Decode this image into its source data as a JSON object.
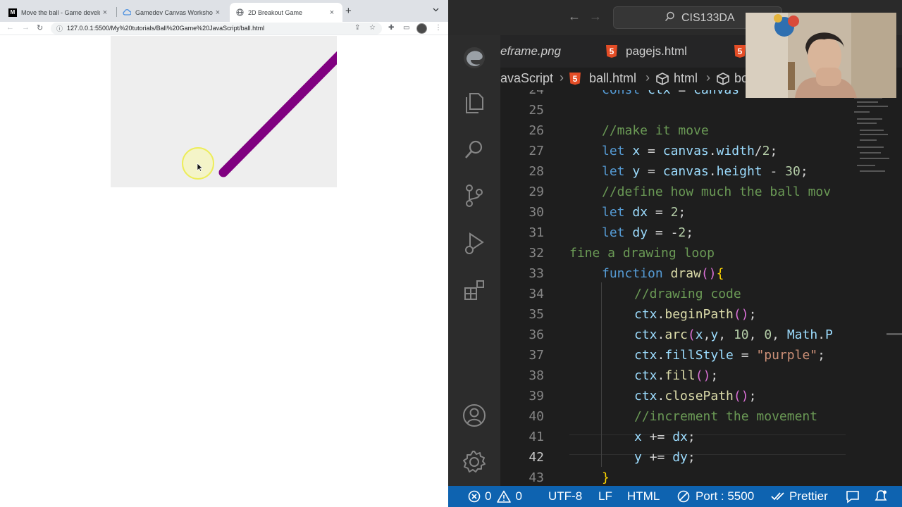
{
  "browser": {
    "tabs": [
      {
        "title": "Move the ball - Game develop",
        "icon": "mdn-icon",
        "active": false
      },
      {
        "title": "Gamedev Canvas Workshop - ",
        "icon": "cloud-icon",
        "active": false
      },
      {
        "title": "2D Breakout Game",
        "icon": "globe-icon",
        "active": true
      }
    ],
    "close_glyph": "×",
    "new_tab_glyph": "+",
    "url": "127.0.0.1:5500/My%20tutorials/Ball%20Game%20JavaScript/ball.html",
    "canvas": {
      "background": "#eeeeee",
      "trail_color": "#800080"
    }
  },
  "vscode": {
    "search_label": "CIS133DA",
    "editor_tabs": [
      {
        "label": "eframe.png",
        "italic": true
      },
      {
        "label": "pagejs.html",
        "italic": false
      }
    ],
    "breadcrumbs": [
      "avaScript",
      "ball.html",
      "html",
      "bo"
    ],
    "lines": [
      {
        "num": "24",
        "text": "const ctx = canvas"
      },
      {
        "num": "25",
        "text": ""
      },
      {
        "num": "26",
        "text": "//make it move"
      },
      {
        "num": "27",
        "text": "let x = canvas.width/2;"
      },
      {
        "num": "28",
        "text": "let y = canvas.height - 30;"
      },
      {
        "num": "29",
        "text": "//define how much the ball mov"
      },
      {
        "num": "30",
        "text": "let dx = 2;"
      },
      {
        "num": "31",
        "text": "let dy = -2;"
      },
      {
        "num": "32",
        "text": "fine a drawing loop"
      },
      {
        "num": "33",
        "text": "function draw(){"
      },
      {
        "num": "34",
        "text": "//drawing code"
      },
      {
        "num": "35",
        "text": "ctx.beginPath();"
      },
      {
        "num": "36",
        "text": "ctx.arc(x,y, 10, 0, Math.P"
      },
      {
        "num": "37",
        "text": "ctx.fillStyle = \"purple\";"
      },
      {
        "num": "38",
        "text": "ctx.fill();"
      },
      {
        "num": "39",
        "text": "ctx.closePath();"
      },
      {
        "num": "40",
        "text": "//increment the movement"
      },
      {
        "num": "41",
        "text": "x += dx;"
      },
      {
        "num": "42",
        "text": "y += dy;"
      },
      {
        "num": "43",
        "text": "}"
      }
    ],
    "current_line": "42",
    "status": {
      "errors": "0",
      "warnings": "0",
      "encoding": "UTF-8",
      "eol": "LF",
      "language": "HTML",
      "port": "Port : 5500",
      "formatter": "Prettier"
    },
    "colors": {
      "statusbar": "#0e63b0",
      "html_icon": "#e44d26"
    }
  }
}
